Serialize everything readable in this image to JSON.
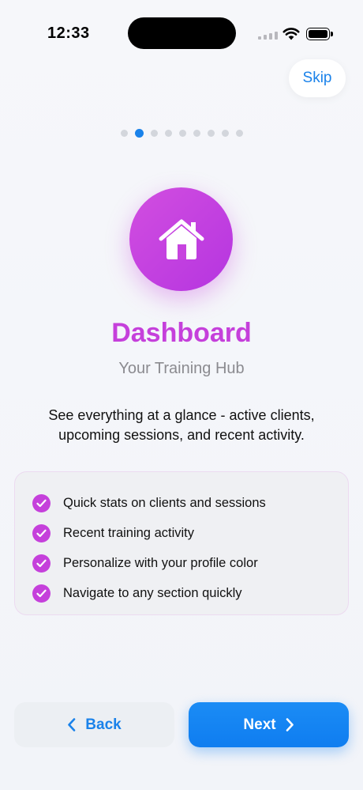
{
  "status_bar": {
    "time": "12:33",
    "icons": [
      "signal-icon",
      "wifi-icon",
      "battery-icon"
    ]
  },
  "skip_label": "Skip",
  "pagination": {
    "total": 9,
    "current": 2
  },
  "hero": {
    "icon": "house-icon",
    "title": "Dashboard",
    "subtitle": "Your Training Hub",
    "description": "See everything at a glance - active clients, upcoming sessions, and recent activity."
  },
  "features": [
    "Quick stats on clients and sessions",
    "Recent training activity",
    "Personalize with your profile color",
    "Navigate to any section quickly"
  ],
  "buttons": {
    "back_label": "Back",
    "next_label": "Next"
  },
  "colors": {
    "accent": "#c540db",
    "primary": "#1a82ea",
    "background": "#f4f5f9"
  }
}
